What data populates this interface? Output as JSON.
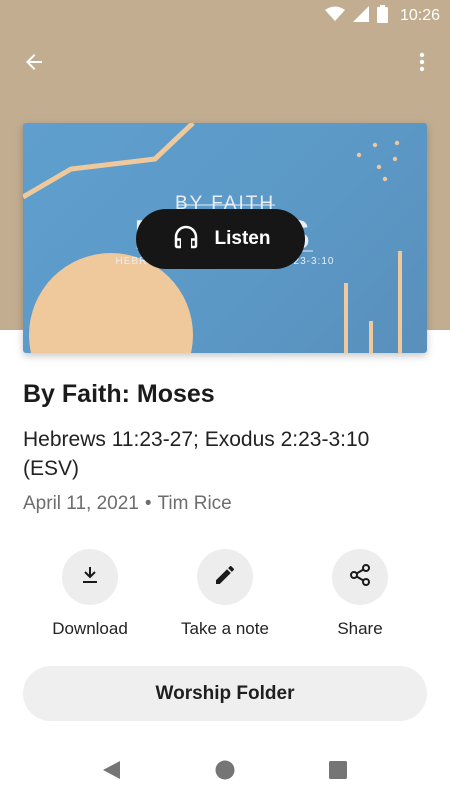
{
  "status_bar": {
    "time": "10:26",
    "icons": [
      "wifi-icon",
      "cell-signal-icon",
      "battery-icon"
    ]
  },
  "app_bar": {
    "back_icon": "arrow-back-icon",
    "more_icon": "more-vert-icon"
  },
  "colors": {
    "header_band": "#c2ad90",
    "artwork_blue": "#5f9fce",
    "artwork_accent": "#efc99c",
    "listen_pill": "#161616"
  },
  "artwork": {
    "title_small": "BY FAITH",
    "title_big": "MOSES",
    "reference": "HEBREWS 11:23-27, EXODUS 2:23-3:10",
    "listen_label": "Listen",
    "listen_icon": "headphones-icon"
  },
  "sermon": {
    "title": "By Faith: Moses",
    "scripture": "Hebrews 11:23-27; Exodus 2:23-3:10 (ESV)",
    "date": "April 11, 2021",
    "separator": "•",
    "speaker": "Tim Rice"
  },
  "actions": [
    {
      "label": "Download",
      "icon": "download-icon"
    },
    {
      "label": "Take a note",
      "icon": "pencil-icon"
    },
    {
      "label": "Share",
      "icon": "share-icon"
    }
  ],
  "worship_folder": {
    "label": "Worship Folder"
  },
  "nav": {
    "icons": [
      "back-triangle-icon",
      "home-circle-icon",
      "recents-square-icon"
    ]
  }
}
